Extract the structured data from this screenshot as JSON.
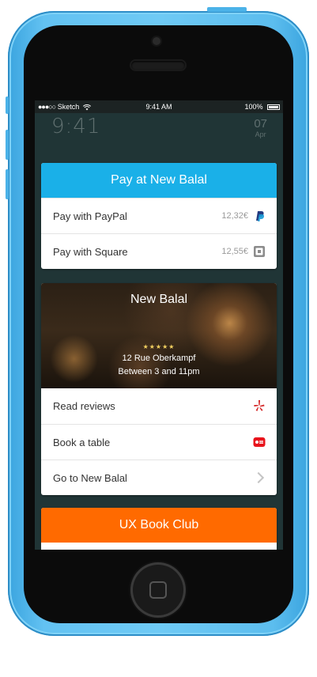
{
  "status_bar": {
    "signal": "●●●○○",
    "carrier": "Sketch",
    "wifi_icon": "wifi-icon",
    "time": "9:41 AM",
    "battery": "100%"
  },
  "lock_screen": {
    "clock": "9:41",
    "day": "07",
    "month": "Apr"
  },
  "pay_card": {
    "title": "Pay at New Balal",
    "header_color": "#1ab0e8",
    "options": [
      {
        "label": "Pay with PayPal",
        "price": "12,32€",
        "icon": "paypal-icon"
      },
      {
        "label": "Pay with Square",
        "price": "12,55€",
        "icon": "square-icon"
      }
    ]
  },
  "venue_card": {
    "name": "New Balal",
    "rating": "★★★★★",
    "address": "12 Rue Oberkampf",
    "hours": "Between 3 and 11pm",
    "actions": [
      {
        "label": "Read reviews",
        "icon": "yelp-icon"
      },
      {
        "label": "Book a table",
        "icon": "booking-icon"
      },
      {
        "label": "Go to New Balal",
        "icon": "chevron-right-icon"
      }
    ]
  },
  "bookclub_card": {
    "title": "UX Book Club",
    "header_color": "#ff6a00"
  }
}
